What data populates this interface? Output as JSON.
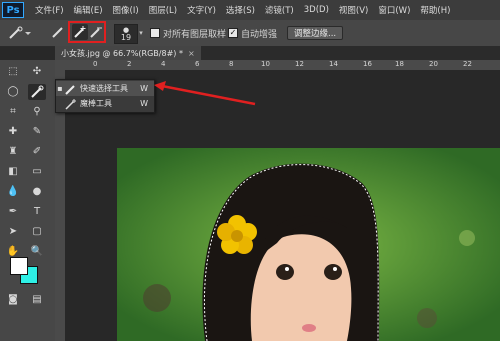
{
  "app": {
    "logo": "Ps"
  },
  "menu": [
    "文件(F)",
    "编辑(E)",
    "图像(I)",
    "图层(L)",
    "文字(Y)",
    "选择(S)",
    "滤镜(T)",
    "3D(D)",
    "视图(V)",
    "窗口(W)",
    "帮助(H)"
  ],
  "options": {
    "brush_size": "19",
    "sample_all_layers": "对所有图层取样",
    "auto_enhance": "自动增强",
    "refine_edge": "调整边缘..."
  },
  "document": {
    "tab_title": "小女孩.jpg @ 66.7%(RGB/8#) *",
    "close": "×"
  },
  "ruler_top": [
    "0",
    "2",
    "4",
    "6",
    "8",
    "10",
    "12",
    "14",
    "16",
    "18",
    "20",
    "22"
  ],
  "flyout": {
    "items": [
      {
        "label": "快速选择工具",
        "key": "W"
      },
      {
        "label": "魔棒工具",
        "key": "W"
      }
    ]
  },
  "colors": {
    "accent": "#e02020",
    "foreground": "#ffffff",
    "background": "#2ef0e6"
  }
}
